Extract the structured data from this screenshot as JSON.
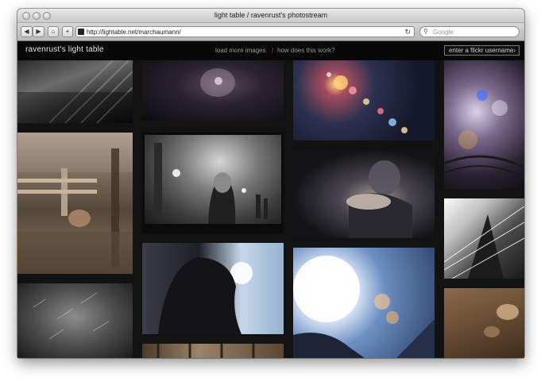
{
  "window": {
    "title": "light table / ravenrust's photostream",
    "url": "http://lightable.net/marchaumann/",
    "search_placeholder": "Google",
    "buttons": {
      "back_glyph": "◀",
      "forward_glyph": "▶",
      "home_glyph": "⌂",
      "add_glyph": "+",
      "reload_glyph": "↻",
      "search_glyph": "⚲"
    }
  },
  "site": {
    "title": "ravenrust's light table",
    "links": [
      "load more images",
      "how does this work?"
    ],
    "separator": "/",
    "username_placeholder": "enter a flickr username",
    "submit_glyph": "›"
  },
  "photos": [
    {
      "id": "stairs-shadow"
    },
    {
      "id": "night-glow"
    },
    {
      "id": "bokeh-lights"
    },
    {
      "id": "purple-bokeh"
    },
    {
      "id": "garden-fence"
    },
    {
      "id": "night-street-woman"
    },
    {
      "id": "motion-blur-portrait"
    },
    {
      "id": "building-lines"
    },
    {
      "id": "sunlit-profile"
    },
    {
      "id": "sun-flare"
    },
    {
      "id": "mono-grass"
    },
    {
      "id": "rocks-brown"
    },
    {
      "id": "rafters"
    }
  ],
  "colors": {
    "background": "#121212",
    "chrome": "#c9c9c9",
    "nav_text": "#9a9a9a",
    "title_text": "#e6e6e6"
  }
}
